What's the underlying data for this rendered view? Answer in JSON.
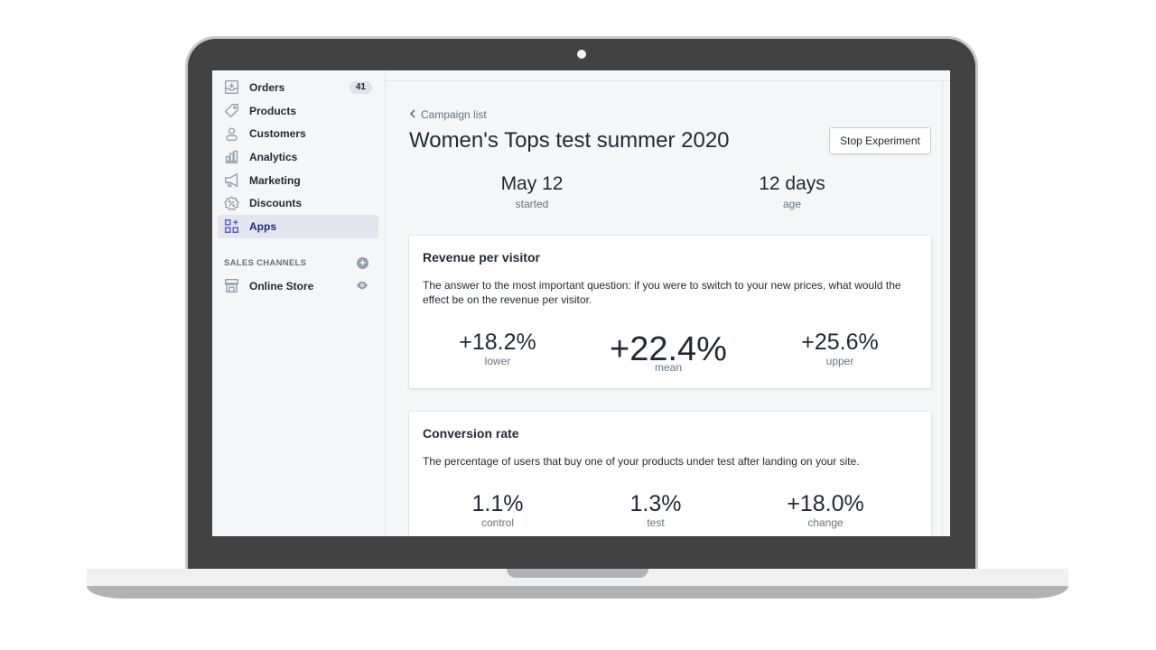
{
  "sidebar": {
    "items": [
      {
        "label": "Orders",
        "icon": "inbox-arrow-icon",
        "badge": "41"
      },
      {
        "label": "Products",
        "icon": "tag-icon"
      },
      {
        "label": "Customers",
        "icon": "person-icon"
      },
      {
        "label": "Analytics",
        "icon": "bar-chart-icon"
      },
      {
        "label": "Marketing",
        "icon": "megaphone-icon"
      },
      {
        "label": "Discounts",
        "icon": "discount-badge-icon"
      },
      {
        "label": "Apps",
        "icon": "apps-grid-plus-icon",
        "active": true
      }
    ],
    "sales_channels": {
      "title": "SALES CHANNELS",
      "add_icon": "plus-circle-icon",
      "items": [
        {
          "label": "Online Store",
          "icon": "store-icon",
          "action_icon": "eye-icon"
        }
      ]
    }
  },
  "main": {
    "breadcrumb": "Campaign list",
    "title": "Women's Tops test summer 2020",
    "stop_button": "Stop Experiment",
    "stats": [
      {
        "value": "May 12",
        "label": "started"
      },
      {
        "value": "12 days",
        "label": "age"
      }
    ],
    "cards": [
      {
        "title": "Revenue per visitor",
        "description": "The answer to the most important question: if you were to switch to your new prices, what would the effect be on the revenue per visitor.",
        "metrics": [
          {
            "value": "+18.2%",
            "label": "lower"
          },
          {
            "value": "+22.4%",
            "label": "mean"
          },
          {
            "value": "+25.6%",
            "label": "upper"
          }
        ]
      },
      {
        "title": "Conversion rate",
        "description": "The percentage of users that buy one of your products under test after landing on your site.",
        "metrics": [
          {
            "value": "1.1%",
            "label": "control"
          },
          {
            "value": "1.3%",
            "label": "test"
          },
          {
            "value": "+18.0%",
            "label": "change"
          }
        ]
      }
    ]
  },
  "colors": {
    "accent": "#5c6ac4",
    "active_bg": "#e3e5ef",
    "text": "#212b36",
    "subdued": "#637381",
    "icon": "#919eab",
    "bezel": "#424242"
  }
}
